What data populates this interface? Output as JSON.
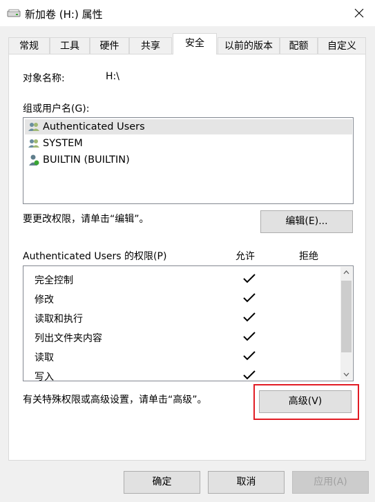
{
  "window": {
    "title": "新加卷 (H:) 属性"
  },
  "tabs": [
    {
      "label": "常规"
    },
    {
      "label": "工具"
    },
    {
      "label": "硬件"
    },
    {
      "label": "共享"
    },
    {
      "label": "安全"
    },
    {
      "label": "以前的版本"
    },
    {
      "label": "配额"
    },
    {
      "label": "自定义"
    }
  ],
  "active_tab": "安全",
  "object": {
    "label": "对象名称:",
    "value": "H:\\"
  },
  "groups": {
    "label": "组或用户名(G):",
    "items": [
      {
        "name": "Authenticated Users",
        "icon": "users-group-icon",
        "selected": true
      },
      {
        "name": "SYSTEM",
        "icon": "users-group-icon",
        "selected": false
      },
      {
        "name": "BUILTIN (BUILTIN)",
        "icon": "user-admin-icon",
        "selected": false
      }
    ]
  },
  "edit": {
    "hint": "要更改权限，请单击“编辑”。",
    "button": "编辑(E)..."
  },
  "permissions": {
    "label": "Authenticated Users 的权限(P)",
    "allow_header": "允许",
    "deny_header": "拒绝",
    "rows": [
      {
        "name": "完全控制",
        "allow": true,
        "deny": false
      },
      {
        "name": "修改",
        "allow": true,
        "deny": false
      },
      {
        "name": "读取和执行",
        "allow": true,
        "deny": false
      },
      {
        "name": "列出文件夹内容",
        "allow": true,
        "deny": false
      },
      {
        "name": "读取",
        "allow": true,
        "deny": false
      },
      {
        "name": "写入",
        "allow": true,
        "deny": false
      }
    ]
  },
  "advanced": {
    "hint": "有关特殊权限或高级设置，请单击“高级”。",
    "button": "高级(V)"
  },
  "footer": {
    "ok": "确定",
    "cancel": "取消",
    "apply": "应用(A)"
  },
  "colors": {
    "highlight_border": "#e21b23",
    "selected_row": "#e5e5e5",
    "disabled_text": "#a0a0a0"
  }
}
